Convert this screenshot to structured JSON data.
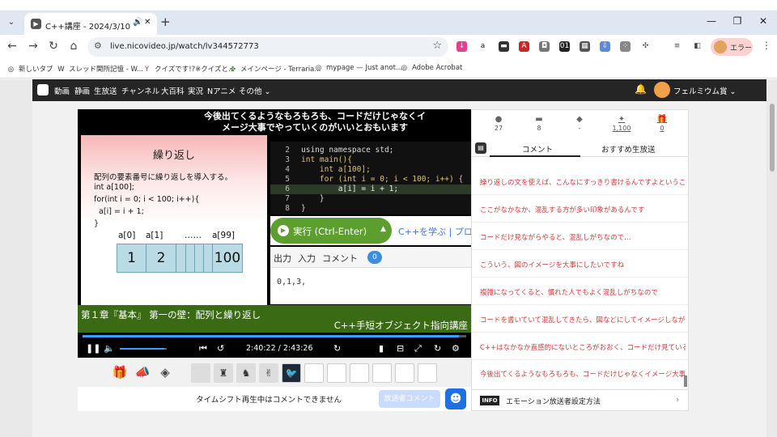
{
  "browser": {
    "tab_title": "C++講座 - 2024/3/10(日) 2:",
    "url": "live.nicovideo.jp/watch/lv344572773",
    "profile_label": "エラー",
    "bookmarks": [
      "新しいタブ",
      "スレッド関所記憶 - W...",
      "クイズです!?※クイズと...",
      "メインページ - Terraria...",
      "mypage — Just anot...",
      "Adobe Acrobat"
    ]
  },
  "site": {
    "nav": [
      "動画",
      "静画",
      "生放送",
      "チャンネル",
      "大百科",
      "実況",
      "Nアニメ",
      "その他"
    ],
    "user_name": "フェルミウム賞"
  },
  "video": {
    "caption_line1": "今後出てくるようなもろもろも、コードだけじゃなくイ",
    "caption_line2": "メージ大事でやっていくのがいいとおもいます",
    "slide": {
      "title": "繰り返し",
      "lines": [
        "配列の要素番号に繰り返しを導入する。",
        "int a[100];",
        "for(int i = 0; i < 100; i++){",
        "  a[i] = i + 1;",
        "}"
      ],
      "index_labels": [
        "a[0]",
        "a[1]",
        "……",
        "a[99]"
      ],
      "cells": [
        "1",
        "2",
        "100"
      ]
    },
    "code": [
      {
        "n": "2",
        "t": "using namespace std;"
      },
      {
        "n": "3",
        "t": "int main(){"
      },
      {
        "n": "4",
        "t": "    int a[100];"
      },
      {
        "n": "5",
        "t": "    for (int i = 0; i < 100; i++) {"
      },
      {
        "n": "6",
        "t": "        a[i] = i + 1;"
      },
      {
        "n": "7",
        "t": "    }"
      },
      {
        "n": "8",
        "t": "}"
      }
    ],
    "run_label": "実行 (Ctrl-Enter)",
    "learn_label": "C++を学ぶ | プロ",
    "io_tabs": [
      "出力",
      "入力",
      "コメント"
    ],
    "io_badge": "0",
    "output": "0,1,3,",
    "chapter": "第１章『基本』 第一の壁：配列と繰り返し",
    "course": "C++手短オブジェクト指向講座",
    "time_current": "2:40:22",
    "time_total": "2:43:26",
    "progress": 0.981,
    "volume": 0.95
  },
  "commentbar": {
    "note": "タイムシフト再生中はコメントできません",
    "post_label": "放送者コメント"
  },
  "panel": {
    "stats": [
      {
        "icon": "viewer-icon",
        "value": "27"
      },
      {
        "icon": "comment-count-icon",
        "value": "8"
      },
      {
        "icon": "ad-icon",
        "value": "-"
      },
      {
        "icon": "gift-point-icon",
        "value": "1,100"
      },
      {
        "icon": "gift-icon",
        "value": "0"
      }
    ],
    "tab_comment": "コメント",
    "tab_recommend": "おすすめ生放送",
    "comments": [
      "繰り返しの文を使えば、こんなにすっきり書けるんですよというこ",
      "ここがなかなか、混乱する方が多い印象があるんです",
      "コードだけ見ながらやると、混乱しがちなので…",
      "こういう、図のイメージを大事にしたいですね",
      "複雑になってくると、慣れた人でもよく混乱しがちなので",
      "コードを書いていて混乱してきたら、図などにしてイメージしなが",
      "C++はなかなか直感的にないところがおおく、コードだけ見ている",
      "今後出てくるようなもろもろも、コードだけじゃなくイメージ大事"
    ],
    "info_badge": "INFO",
    "info_text": "エモーション放送者設定方法"
  }
}
